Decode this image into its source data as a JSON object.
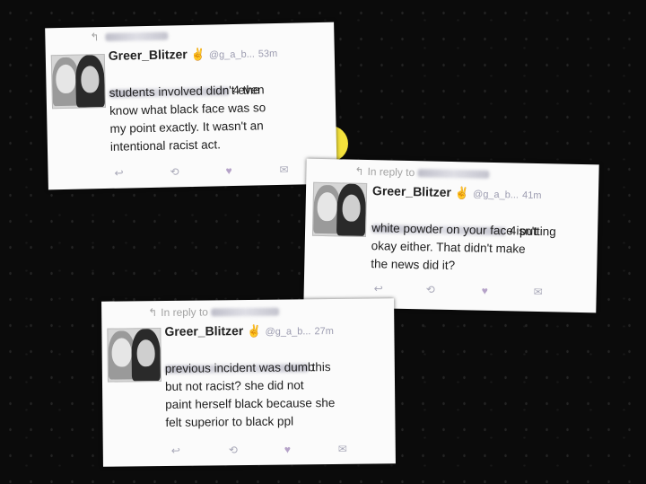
{
  "tweets": [
    {
      "reply_to": "",
      "username": "Greer_Blitzer",
      "peace": "✌",
      "handle": "@g_a_b...",
      "time": "53m",
      "body_lead": "4 the",
      "body": "students involved didn't even\nknow what black face was so\nmy point exactly. It wasn't an\nintentional racist act."
    },
    {
      "reply_to": "In reply to",
      "username": "Greer_Blitzer",
      "peace": "✌",
      "handle": "@g_a_b...",
      "time": "41m",
      "body_lead": "4 putting",
      "body": "white powder on your face isn't\nokay either. That didn't make\nthe news did it?"
    },
    {
      "reply_to": "In reply to",
      "username": "Greer_Blitzer",
      "peace": "✌",
      "handle": "@g_a_b...",
      "time": "27m",
      "body_lead": "this",
      "body": "previous incident was dumb\nbut not racist? she did not\npaint herself black because she\nfelt superior to black ppl"
    }
  ],
  "icons": {
    "reply": "reply-icon",
    "retweet": "retweet-icon",
    "like": "heart-icon",
    "dm": "message-icon"
  },
  "colors": {
    "background": "#0b0b0b",
    "card": "#fbfbfb",
    "meta": "#9c9cb0",
    "peace": "#e2b23d"
  }
}
